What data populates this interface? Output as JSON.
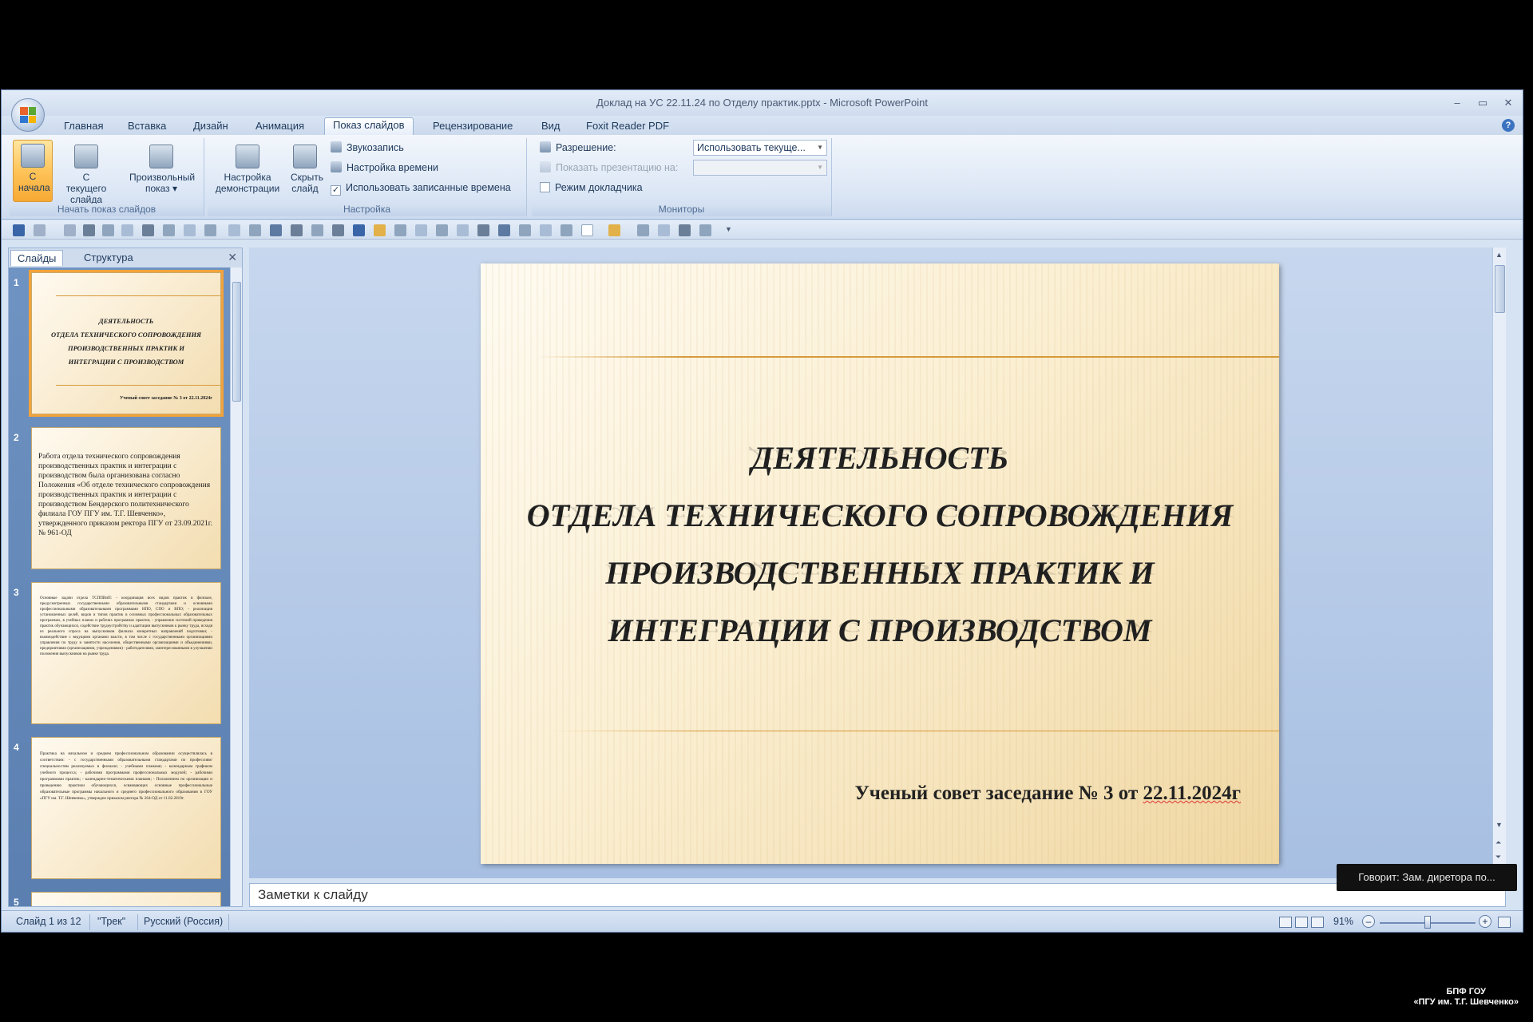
{
  "window": {
    "title": "Доклад на УС 22.11.24 по Отделу практик.pptx - Microsoft PowerPoint",
    "controls": {
      "minimize": "–",
      "maximize": "▭",
      "close": "✕"
    }
  },
  "tabs": [
    {
      "label": "Главная"
    },
    {
      "label": "Вставка"
    },
    {
      "label": "Дизайн"
    },
    {
      "label": "Анимация"
    },
    {
      "label": "Показ слайдов",
      "active": true
    },
    {
      "label": "Рецензирование"
    },
    {
      "label": "Вид"
    },
    {
      "label": "Foxit Reader PDF"
    }
  ],
  "help_label": "?",
  "ribbon": {
    "start_group": {
      "label": "Начать показ слайдов",
      "from_beginning": "С начала",
      "from_current": "С текущего слайда",
      "custom_show": "Произвольный показ ▾"
    },
    "setup_group": {
      "label": "Настройка",
      "setup_show": "Настройка демонстрации",
      "hide_slide": "Скрыть слайд",
      "record_narration": "Звукозапись",
      "rehearse_timings": "Настройка времени",
      "use_timings": "Использовать записанные времена",
      "use_timings_checked": "✓"
    },
    "monitors_group": {
      "label": "Мониторы",
      "resolution_label": "Разрешение:",
      "resolution_value": "Использовать текуще...",
      "show_on_label": "Показать презентацию на:",
      "show_on_value": "",
      "presenter_view": "Режим докладчика"
    }
  },
  "left_pane": {
    "tab_slides": "Слайды",
    "tab_outline": "Структура",
    "close": "✕",
    "thumbnails": [
      {
        "num": "1",
        "title_lines": [
          "ДЕЯТЕЛЬНОСТЬ",
          "ОТДЕЛА ТЕХНИЧЕСКОГО СОПРОВОЖДЕНИЯ",
          "ПРОИЗВОДСТВЕННЫХ ПРАКТИК И",
          "ИНТЕГРАЦИИ С ПРОИЗВОДСТВОМ"
        ],
        "footer": "Ученый совет заседание № 3 от 22.11.2024г"
      },
      {
        "num": "2",
        "body": "Работа отдела технического сопровождения производственных практик и интеграции с производством была организована согласно Положения «Об отделе технического сопровождения производственных практик и интеграции с производством Бендерского политехнического филиала ГОУ ПГУ им. Т.Г. Шевченко», утвержденного приказом ректора ПГУ от 23.09.2021г. № 961-ОД"
      },
      {
        "num": "3",
        "body": "Основные задачи отдела ТСППИиП: - координация всех видов практик в филиале, предусмотренных государственными образовательными стандартами и основными профессиональными образовательными программами НПО, СПО и ВПО; - реализация установленных целей, видов и типов практик в основных профессиональных образовательных программах, в учебных планах и рабочих программах практик; - управление системой проведения практик обучающихся, содействие трудоустройству и адаптации выпускников к рынку труда, исходя из реального спроса на выпускников филиала конкретных направлений подготовки; - взаимодействие с ведущими органами власти, в том числе с государственными организациями управления по труду и занятости населения, общественными организациями и объединениями, предприятиями (организациями, учреждениями) - работодателями, заинтересованными в улучшении положения выпускников на рынке труда."
      },
      {
        "num": "4",
        "body": "Практика на начальном и среднем профессиональном образовании осуществлялась в соответствии: - с государственными образовательными стандартами по профессиям/специальностям реализуемых в филиале; - учебными планами; - календарным графиком учебного процесса; - рабочими программами профессиональных модулей; - рабочими программами практик; - календарно-тематическими планами; - Положением по организации и проведению практики обучающихся, осваивающих основные профессиональные образовательные программы начального и среднего профессионального образования в ГОУ «ПГУ им. Т.Г. Шевченко», утвержден приказом ректора № 264-ОД от 11.02.2019г."
      },
      {
        "num": "5"
      }
    ]
  },
  "slide": {
    "title_lines": [
      "ДЕЯТЕЛЬНОСТЬ",
      "ОТДЕЛА  ТЕХНИЧЕСКОГО СОПРОВОЖДЕНИЯ",
      "ПРОИЗВОДСТВЕННЫХ  ПРАКТИК И",
      "ИНТЕГРАЦИИ  С ПРОИЗВОДСТВОМ"
    ],
    "footer_prefix": "Ученый совет заседание № 3 от ",
    "footer_date": "22.11.2024г"
  },
  "notes": {
    "placeholder": "Заметки к слайду"
  },
  "status": {
    "slide_counter": "Слайд 1 из 12",
    "theme": "\"Трек\"",
    "language": "Русский (Россия)",
    "zoom": "91%",
    "zoom_out": "–",
    "zoom_in": "+",
    "zoom_fraction": 0.5
  },
  "overlay": {
    "speaker": "Говорит: Зам. диретора по...",
    "watermark_line1": "БПФ ГОУ",
    "watermark_line2": "«ПГУ им. Т.Г. Шевченко»"
  },
  "colors": {
    "accent": "#f2a33a",
    "ribbon": "#dbe6f5",
    "slide_bg": "#fbefd2"
  }
}
